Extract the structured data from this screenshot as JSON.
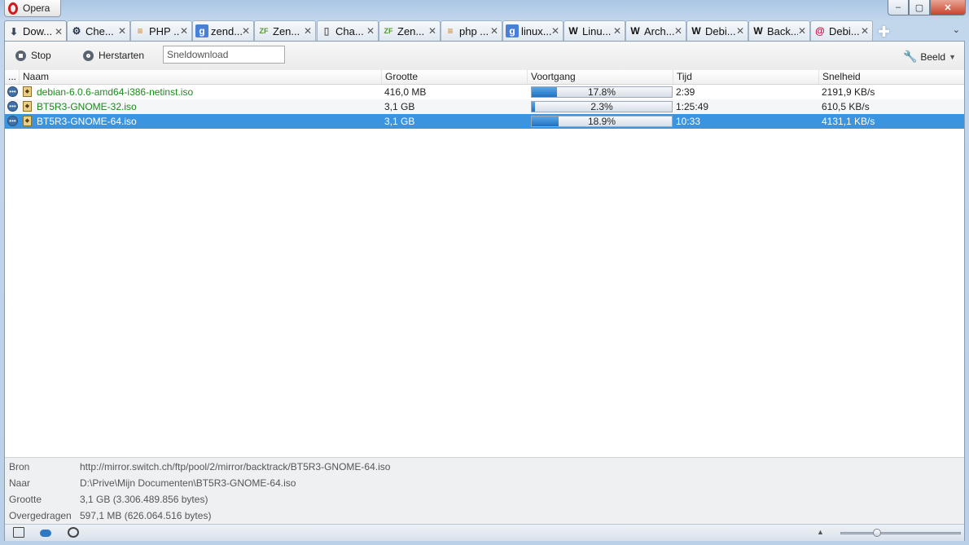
{
  "app": {
    "menu_label": "Opera"
  },
  "window_controls": {
    "minimize": "–",
    "maximize": "▢",
    "close": "✕"
  },
  "tabs": [
    {
      "label": "Dow...",
      "icon": "download-icon",
      "active": true
    },
    {
      "label": "Che...",
      "icon": "gear-icon"
    },
    {
      "label": "PHP ...",
      "icon": "stackoverflow-icon"
    },
    {
      "label": "zend...",
      "icon": "google-icon"
    },
    {
      "label": "Zen...",
      "icon": "zend-icon"
    },
    {
      "label": "Cha...",
      "icon": "page-icon"
    },
    {
      "label": "Zen...",
      "icon": "zend-icon"
    },
    {
      "label": "php ...",
      "icon": "stackoverflow-icon"
    },
    {
      "label": "linux...",
      "icon": "google-icon"
    },
    {
      "label": "Linu...",
      "icon": "wikipedia-icon"
    },
    {
      "label": "Arch...",
      "icon": "wikipedia-icon"
    },
    {
      "label": "Debi...",
      "icon": "wikipedia-icon"
    },
    {
      "label": "Back...",
      "icon": "wikipedia-icon"
    },
    {
      "label": "Debi...",
      "icon": "debian-icon"
    }
  ],
  "toolbar": {
    "stop_label": "Stop",
    "restart_label": "Herstarten",
    "quick_download_placeholder": "Sneldownload",
    "view_label": "Beeld"
  },
  "list": {
    "columns": {
      "more": "...",
      "name": "Naam",
      "size": "Grootte",
      "progress": "Voortgang",
      "time": "Tijd",
      "speed": "Snelheid"
    },
    "rows": [
      {
        "name": "debian-6.0.6-amd64-i386-netinst.iso",
        "size": "416,0 MB",
        "progress_pct": 17.8,
        "progress_label": "17.8%",
        "time": "2:39",
        "speed": "2191,9 KB/s"
      },
      {
        "name": "BT5R3-GNOME-32.iso",
        "size": "3,1 GB",
        "progress_pct": 2.3,
        "progress_label": "2.3%",
        "time": "1:25:49",
        "speed": "610,5 KB/s"
      },
      {
        "name": "BT5R3-GNOME-64.iso",
        "size": "3,1 GB",
        "progress_pct": 18.9,
        "progress_label": "18.9%",
        "time": "10:33",
        "speed": "4131,1 KB/s",
        "selected": true
      }
    ]
  },
  "details": {
    "source_key": "Bron",
    "source_val": "http://mirror.switch.ch/ftp/pool/2/mirror/backtrack/BT5R3-GNOME-64.iso",
    "dest_key": "Naar",
    "dest_val": "D:\\Prive\\Mijn Documenten\\BT5R3-GNOME-64.iso",
    "size_key": "Grootte",
    "size_val": "3,1 GB (3.306.489.856 bytes)",
    "transferred_key": "Overgedragen",
    "transferred_val": "597,1 MB (626.064.516 bytes)"
  },
  "statusbar": {
    "zoom_fraction": 0.28
  },
  "colors": {
    "selection": "#3b94e0",
    "green_name": "#1a8a1a",
    "opera_red": "#d31a1a"
  }
}
